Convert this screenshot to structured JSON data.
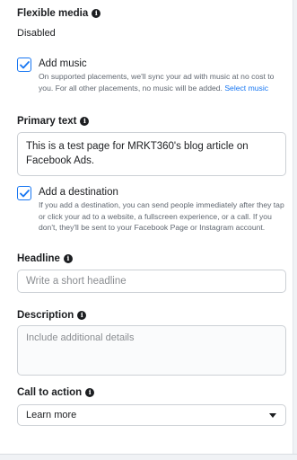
{
  "flexible_media": {
    "title": "Flexible media",
    "status": "Disabled"
  },
  "add_music": {
    "label": "Add music",
    "checked": true,
    "help_text": "On supported placements, we'll sync your ad with music at no cost to you. For all other placements, no music will be added.",
    "link_text": "Select music"
  },
  "primary_text": {
    "title": "Primary text",
    "value": "This is a test page for MRKT360's blog article on Facebook Ads."
  },
  "add_destination": {
    "label": "Add a destination",
    "checked": true,
    "help_text": "If you add a destination, you can send people immediately after they tap or click your ad to a website, a fullscreen experience, or a call. If you don't, they'll be sent to your Facebook Page or Instagram account."
  },
  "headline": {
    "title": "Headline",
    "placeholder": "Write a short headline",
    "value": ""
  },
  "description": {
    "title": "Description",
    "placeholder": "Include additional details",
    "value": ""
  },
  "call_to_action": {
    "title": "Call to action",
    "selected": "Learn more"
  },
  "colors": {
    "accent": "#1877f2",
    "text": "#1c1e21",
    "muted": "#606770",
    "border": "#ccd0d5"
  }
}
